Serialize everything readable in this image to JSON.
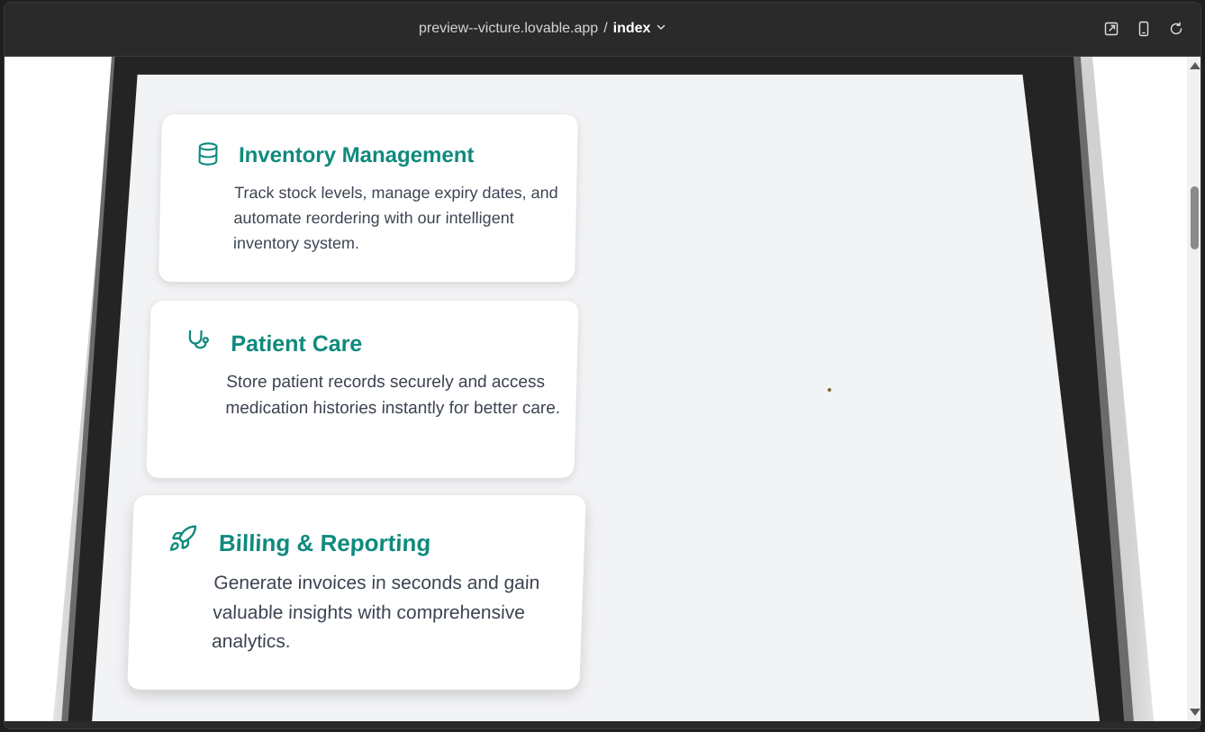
{
  "browser": {
    "host": "preview--victure.lovable.app",
    "separator": "/",
    "page": "index",
    "icons": [
      "open-external-icon",
      "mobile-device-icon",
      "refresh-icon"
    ]
  },
  "features": [
    {
      "icon": "database-icon",
      "title": "Inventory Management",
      "text": "Track stock levels, manage expiry dates, and automate reordering with our intelligent inventory system."
    },
    {
      "icon": "stethoscope-icon",
      "title": "Patient Care",
      "text": "Store patient records securely and access medication histories instantly for better care."
    },
    {
      "icon": "rocket-icon",
      "title": "Billing & Reporting",
      "text": "Generate invoices in seconds and gain valuable insights with comprehensive analytics."
    }
  ],
  "colors": {
    "accent": "#0f8a7e",
    "body_text": "#3c4452",
    "screen_bg": "#f2f3f5"
  }
}
